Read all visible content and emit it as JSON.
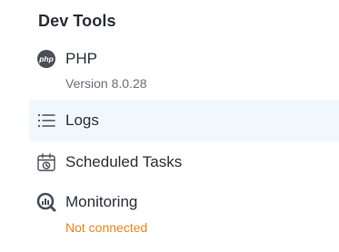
{
  "section": {
    "title": "Dev Tools"
  },
  "items": [
    {
      "label": "PHP",
      "subtitle": "Version 8.0.28",
      "icon": "php-icon"
    },
    {
      "label": "Logs",
      "icon": "list-icon",
      "active": true
    },
    {
      "label": "Scheduled Tasks",
      "icon": "calendar-clock-icon"
    },
    {
      "label": "Monitoring",
      "subtitle": "Not connected",
      "icon": "monitoring-icon",
      "subtitle_color": "#e8871a"
    }
  ]
}
